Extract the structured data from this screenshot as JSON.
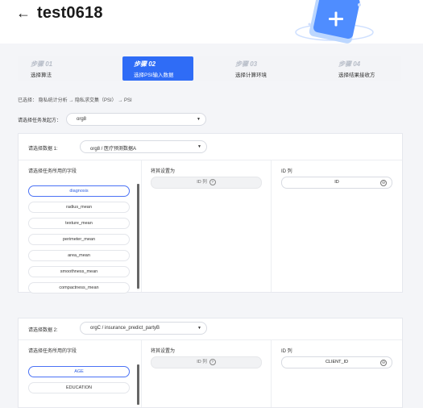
{
  "header": {
    "back_glyph": "←",
    "title": "test0618"
  },
  "steps": [
    {
      "num": "步骤 01",
      "label": "选择算法",
      "active": false
    },
    {
      "num": "步骤 02",
      "label": "选择PSI输入数据",
      "active": true
    },
    {
      "num": "步骤 03",
      "label": "选择计算环境",
      "active": false
    },
    {
      "num": "步骤 04",
      "label": "选择结果接收方",
      "active": false
    }
  ],
  "breadcrumb": "已选择：   隐私统计分析  →  隐私求交集（PSI） →  PSI",
  "initiator": {
    "label": "请选择任务发起方：",
    "value": "org8"
  },
  "dataset1": {
    "label": "请选择数据 1:",
    "value": "org8 / 医疗预测数据A",
    "fields_title": "请选择任务所用的字段",
    "fields": [
      "diagnosis",
      "radius_mean",
      "texture_mean",
      "perimeter_mean",
      "area_mean",
      "smoothness_mean",
      "compactness_mean"
    ],
    "selected_field": "diagnosis",
    "set_as_title": "将其设置为",
    "set_as_value": "ID 列",
    "id_title": "ID 列",
    "id_value": "ID"
  },
  "dataset2": {
    "label": "请选择数据 2:",
    "value": "orgC / insurance_predict_partyB",
    "fields_title": "请选择任务所用的字段",
    "fields": [
      "AGE",
      "EDUCATION"
    ],
    "selected_field": "AGE",
    "set_as_title": "将其设置为",
    "set_as_value": "ID 列",
    "id_title": "ID 列",
    "id_value": "CLIENT_ID"
  },
  "colors": {
    "accent": "#2f6cf6",
    "background": "#f4f5f8"
  },
  "icons": {
    "back": "arrow-left-icon",
    "help": "question-circle-icon",
    "clear": "close-circle-icon",
    "caret": "caret-down-icon"
  }
}
